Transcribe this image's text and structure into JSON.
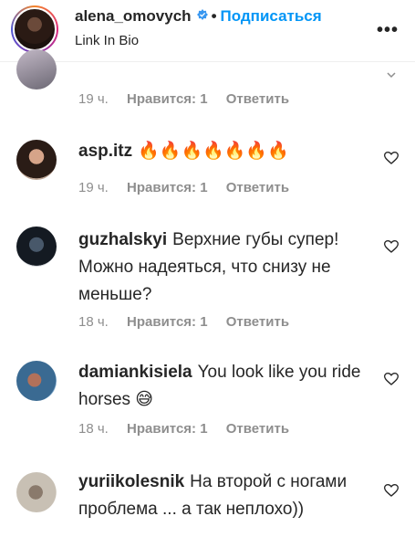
{
  "header": {
    "username": "alena_omovych",
    "verified_icon": "verified-badge-icon",
    "separator": "•",
    "follow_label": "Подписаться",
    "subtitle": "Link In Bio",
    "more_label": "•••"
  },
  "comments": [
    {
      "username": "",
      "text": "",
      "time": "19 ч.",
      "likes": "Нравится: 1",
      "reply": "Ответить"
    },
    {
      "username": "asp.itz",
      "text": "🔥🔥🔥🔥🔥🔥🔥",
      "time": "19 ч.",
      "likes": "Нравится: 1",
      "reply": "Ответить"
    },
    {
      "username": "guzhalskyi",
      "text": "Верхние губы супер! Можно надеяться, что снизу не меньше?",
      "time": "18 ч.",
      "likes": "Нравится: 1",
      "reply": "Ответить"
    },
    {
      "username": "damiankisiela",
      "text": "You look like you ride horses 😅",
      "time": "18 ч.",
      "likes": "Нравится: 1",
      "reply": "Ответить"
    },
    {
      "username": "yuriikolesnik",
      "text": "На второй с ногами проблема ... а так неплохо))",
      "time": "",
      "likes": "",
      "reply": ""
    }
  ],
  "icons": {
    "heart": "heart-icon",
    "chevron": "chevron-down-icon",
    "more": "more-icon"
  },
  "colors": {
    "follow": "#0095f6",
    "meta": "#8e8e8e",
    "text": "#262626"
  }
}
